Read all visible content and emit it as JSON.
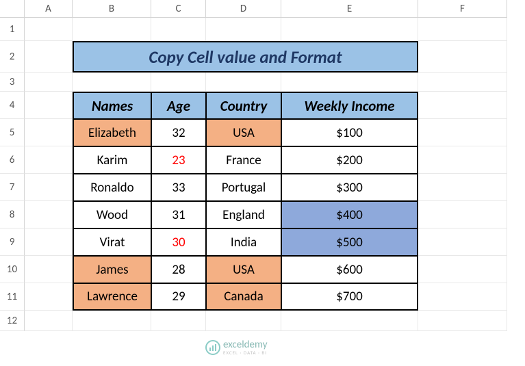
{
  "columns": [
    "A",
    "B",
    "C",
    "D",
    "E",
    "F"
  ],
  "rows": [
    "1",
    "2",
    "3",
    "4",
    "5",
    "6",
    "7",
    "8",
    "9",
    "10",
    "11",
    "12"
  ],
  "title": "Copy Cell value and Format",
  "headers": {
    "names": "Names",
    "age": "Age",
    "country": "Country",
    "income": "Weekly Income"
  },
  "data_rows": [
    {
      "name": "Elizabeth",
      "age": "32",
      "country": "USA",
      "income": "$100",
      "name_cls": "orange",
      "age_cls": "",
      "country_cls": "orange",
      "income_cls": ""
    },
    {
      "name": "Karim",
      "age": "23",
      "country": "France",
      "income": "$200",
      "name_cls": "",
      "age_cls": "red-text",
      "country_cls": "",
      "income_cls": ""
    },
    {
      "name": "Ronaldo",
      "age": "33",
      "country": "Portugal",
      "income": "$300",
      "name_cls": "",
      "age_cls": "",
      "country_cls": "",
      "income_cls": ""
    },
    {
      "name": "Wood",
      "age": "31",
      "country": "England",
      "income": "$400",
      "name_cls": "",
      "age_cls": "",
      "country_cls": "",
      "income_cls": "blue"
    },
    {
      "name": "Virat",
      "age": "30",
      "country": "India",
      "income": "$500",
      "name_cls": "",
      "age_cls": "red-text",
      "country_cls": "",
      "income_cls": "blue"
    },
    {
      "name": "James",
      "age": "28",
      "country": "USA",
      "income": "$600",
      "name_cls": "orange",
      "age_cls": "",
      "country_cls": "orange",
      "income_cls": ""
    },
    {
      "name": "Lawrence",
      "age": "29",
      "country": "Canada",
      "income": "$700",
      "name_cls": "orange",
      "age_cls": "",
      "country_cls": "orange",
      "income_cls": ""
    }
  ],
  "watermark": {
    "brand": "exceldemy",
    "tag": "EXCEL · DATA · BI"
  },
  "chart_data": {
    "type": "table",
    "title": "Copy Cell value and Format",
    "columns": [
      "Names",
      "Age",
      "Country",
      "Weekly Income"
    ],
    "rows": [
      [
        "Elizabeth",
        32,
        "USA",
        100
      ],
      [
        "Karim",
        23,
        "France",
        200
      ],
      [
        "Ronaldo",
        33,
        "Portugal",
        300
      ],
      [
        "Wood",
        31,
        "England",
        400
      ],
      [
        "Virat",
        30,
        "India",
        500
      ],
      [
        "James",
        28,
        "USA",
        600
      ],
      [
        "Lawrence",
        29,
        "Canada",
        700
      ]
    ]
  }
}
